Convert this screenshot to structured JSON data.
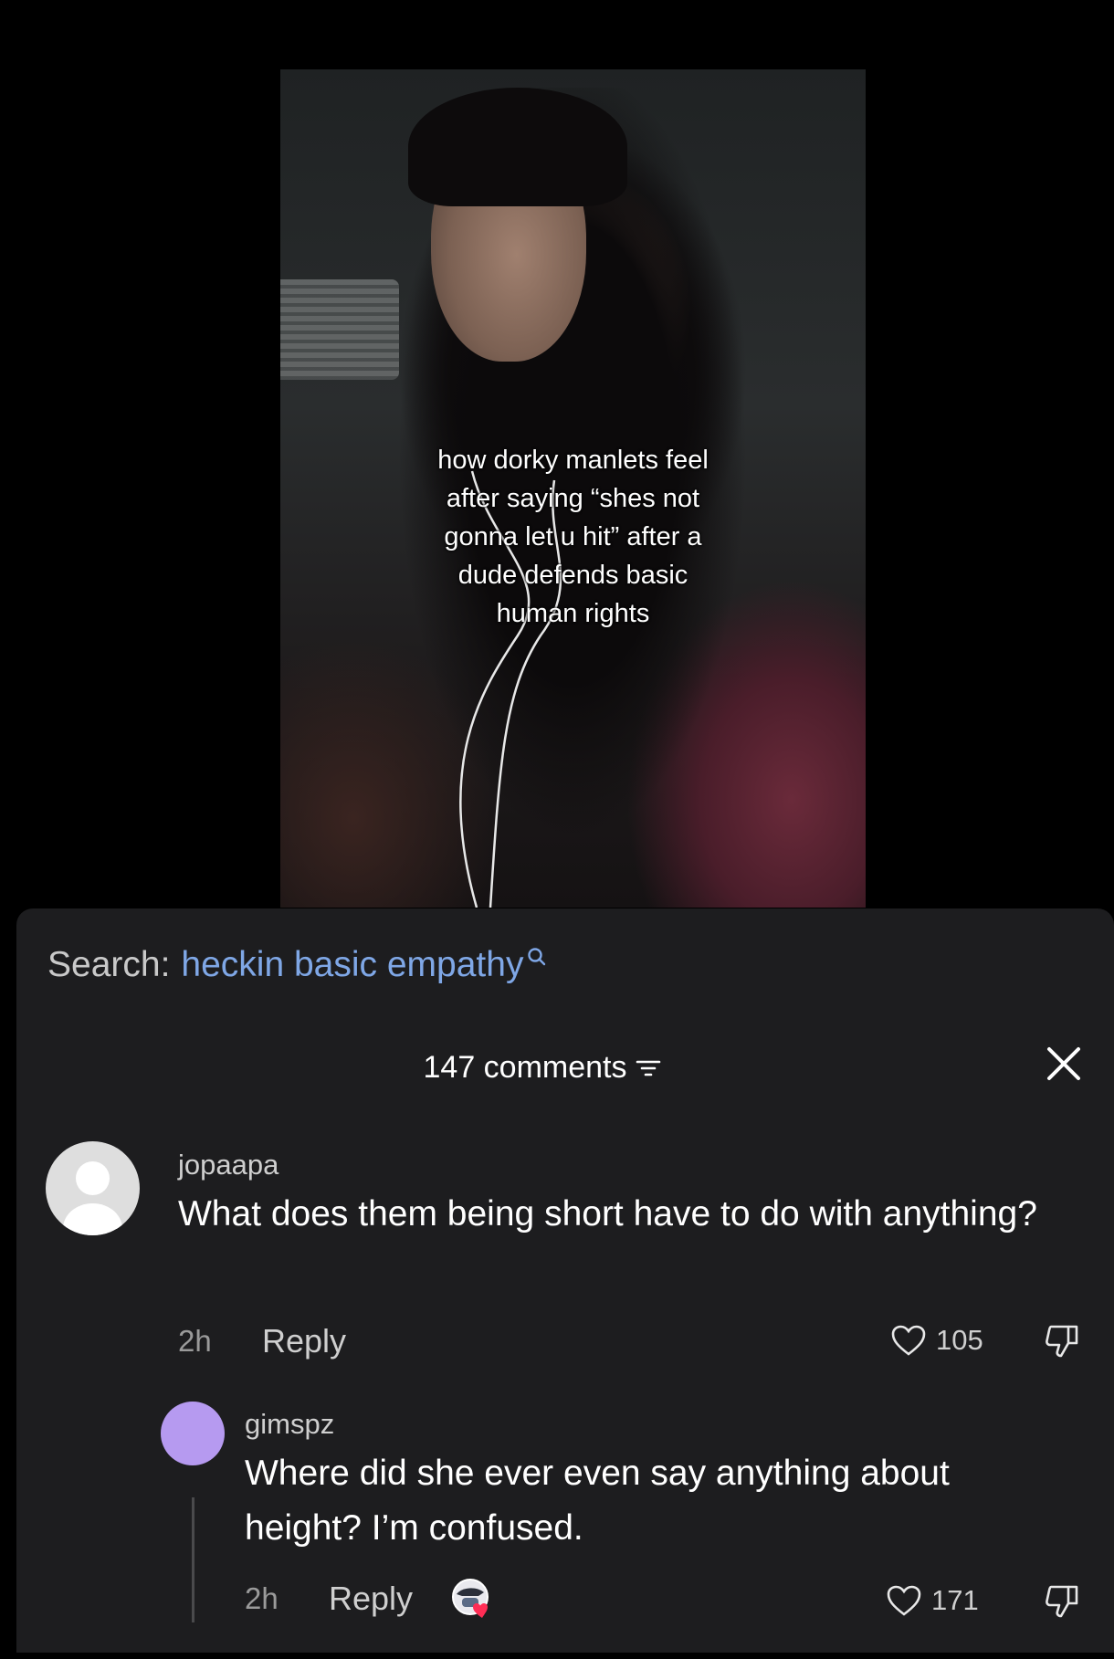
{
  "video": {
    "caption_lines": [
      "how dorky manlets feel",
      "after saying “shes not",
      "gonna let u hit” after a",
      "dude defends basic",
      "human rights"
    ]
  },
  "search": {
    "label": "Search:",
    "query": "heckin basic empathy",
    "icon": "search-icon"
  },
  "comments_header": {
    "count_label": "147 comments",
    "filter_icon": "filter-icon",
    "close_icon": "close-icon"
  },
  "comments": [
    {
      "username": "jopaapa",
      "text": "What does them being short have to do with anything?",
      "time": "2h",
      "reply_label": "Reply",
      "likes": "105",
      "avatar": "default-avatar-icon"
    },
    {
      "username": "gimspz",
      "text": "Where did she ever even say anything about height? I’m confused.",
      "time": "2h",
      "reply_label": "Reply",
      "likes": "171",
      "avatar_color": "#b69af0",
      "liked_by_creator": true
    }
  ],
  "colors": {
    "sheet_bg": "#1d1d1f",
    "search_query": "#7fa7e6",
    "avatar_purple": "#b69af0",
    "creator_heart": "#ff2d55"
  }
}
